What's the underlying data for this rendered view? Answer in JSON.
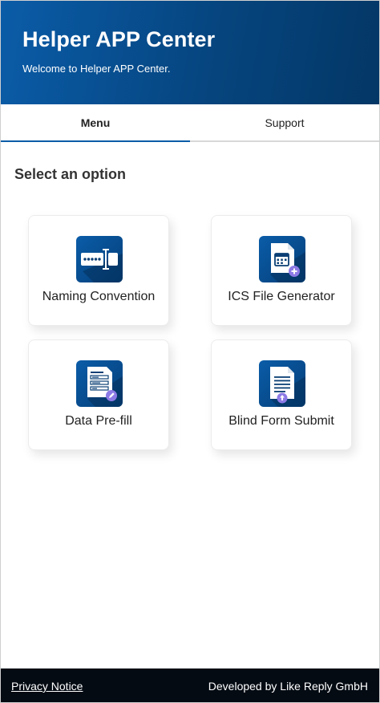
{
  "header": {
    "title": "Helper APP Center",
    "subtitle": "Welcome to Helper APP Center."
  },
  "tabs": [
    {
      "label": "Menu",
      "active": true
    },
    {
      "label": "Support",
      "active": false
    }
  ],
  "main": {
    "section_title": "Select an option",
    "options": [
      {
        "label": "Naming Convention",
        "icon": "password-field-icon"
      },
      {
        "label": "ICS File Generator",
        "icon": "calendar-file-add-icon"
      },
      {
        "label": "Data Pre-fill",
        "icon": "form-edit-icon"
      },
      {
        "label": "Blind Form Submit",
        "icon": "document-upload-icon"
      }
    ]
  },
  "footer": {
    "privacy_label": "Privacy Notice",
    "developer_text": "Developed by Like Reply GmbH"
  },
  "colors": {
    "header_gradient_start": "#0a5ca8",
    "header_gradient_end": "#033766",
    "accent": "#0a5ca8",
    "footer_bg": "#040b13"
  }
}
